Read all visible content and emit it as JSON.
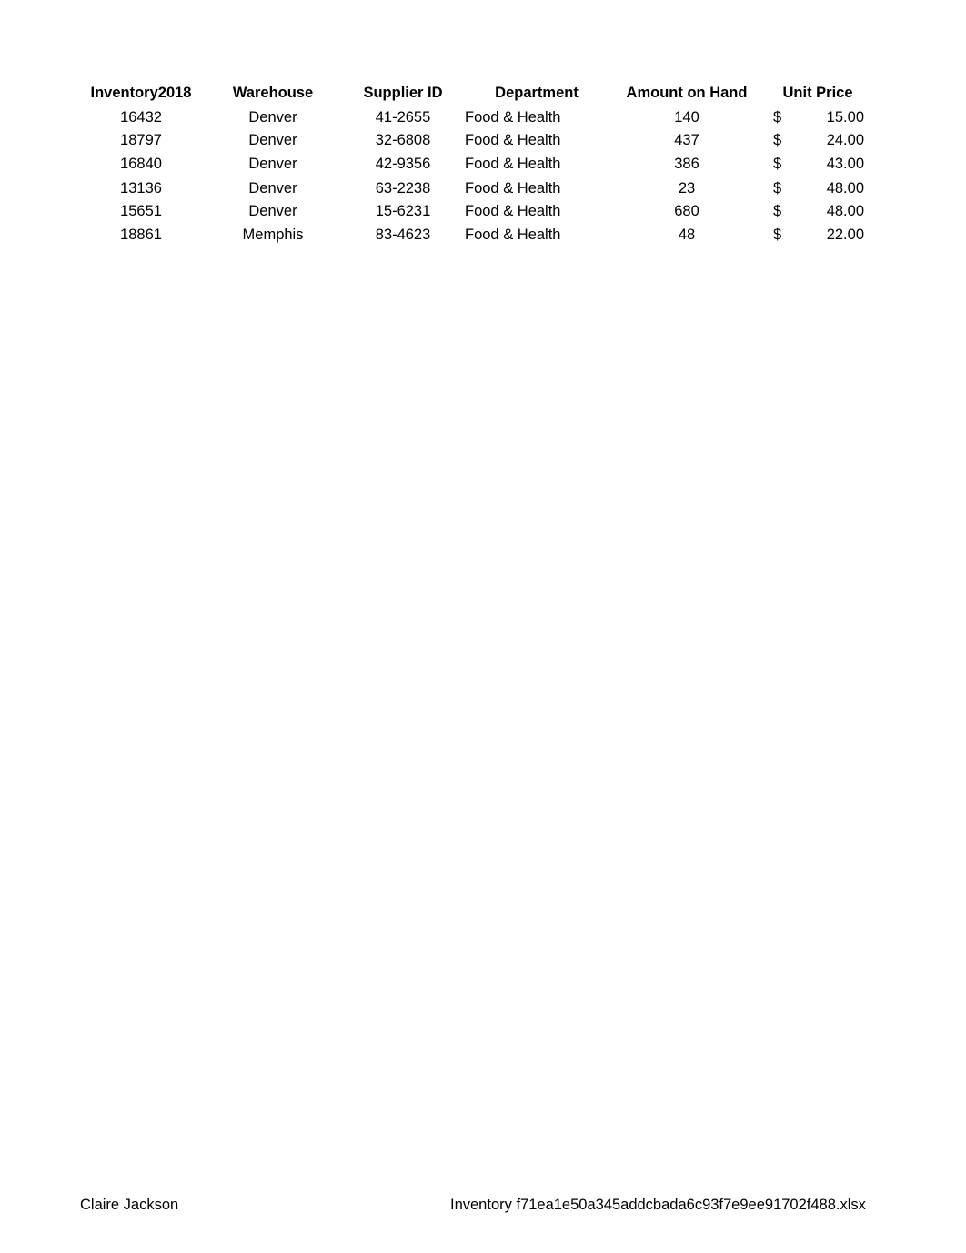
{
  "table": {
    "headers": {
      "inventory": "Inventory2018",
      "warehouse": "Warehouse",
      "supplier_id": "Supplier ID",
      "department": "Department",
      "amount_on_hand": "Amount on Hand",
      "unit_price": "Unit Price"
    },
    "currency_symbol": "$",
    "rows": [
      {
        "inventory": "16432",
        "warehouse": "Denver",
        "supplier_id": "41-2655",
        "department": "Food & Health",
        "amount_on_hand": "140",
        "unit_price": "15.00"
      },
      {
        "inventory": "18797",
        "warehouse": "Denver",
        "supplier_id": "32-6808",
        "department": "Food & Health",
        "amount_on_hand": "437",
        "unit_price": "24.00"
      },
      {
        "inventory": "16840",
        "warehouse": "Denver",
        "supplier_id": "42-9356",
        "department": "Food & Health",
        "amount_on_hand": "386",
        "unit_price": "43.00"
      },
      {
        "inventory": "13136",
        "warehouse": "Denver",
        "supplier_id": "63-2238",
        "department": "Food & Health",
        "amount_on_hand": "23",
        "unit_price": "48.00"
      },
      {
        "inventory": "15651",
        "warehouse": "Denver",
        "supplier_id": "15-6231",
        "department": "Food & Health",
        "amount_on_hand": "680",
        "unit_price": "48.00"
      },
      {
        "inventory": "18861",
        "warehouse": "Memphis",
        "supplier_id": "83-4623",
        "department": "Food & Health",
        "amount_on_hand": "48",
        "unit_price": "22.00"
      }
    ]
  },
  "footer": {
    "left": "Claire Jackson",
    "right": "Inventory f71ea1e50a345addcbada6c93f7e9ee91702f488.xlsx"
  }
}
